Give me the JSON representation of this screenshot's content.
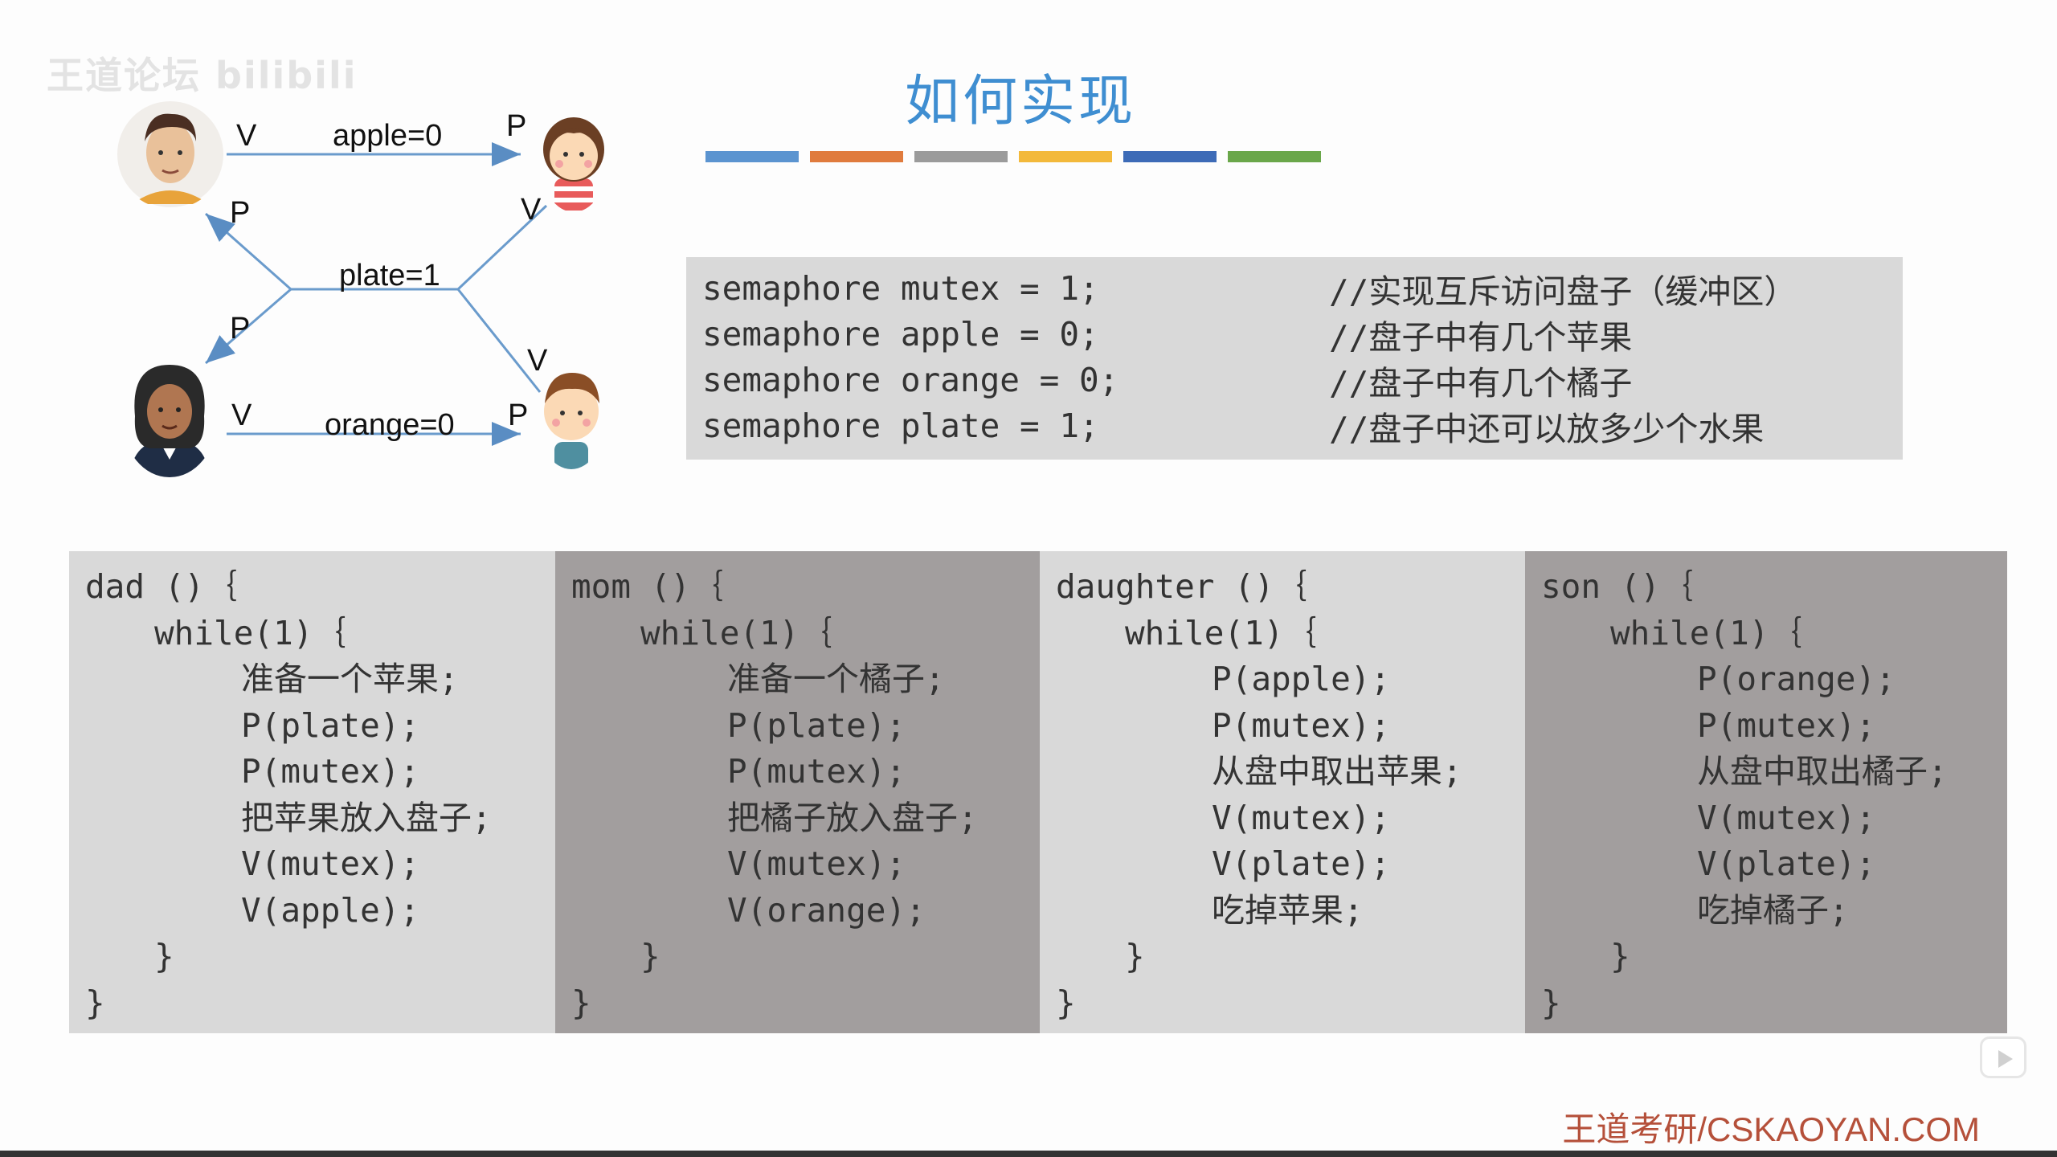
{
  "watermark": "王道论坛 bilibili",
  "title": "如何实现",
  "color_bars": [
    "#5b94d0",
    "#e07b3d",
    "#9b9b9b",
    "#f3b93b",
    "#3d6bb7",
    "#6aa74a"
  ],
  "declarations": [
    {
      "code": "semaphore mutex = 1;",
      "comment": "//实现互斥访问盘子（缓冲区）"
    },
    {
      "code": "semaphore apple = 0;",
      "comment": "//盘子中有几个苹果"
    },
    {
      "code": "semaphore orange = 0;",
      "comment": "//盘子中有几个橘子"
    },
    {
      "code": "semaphore plate = 1;",
      "comment": "//盘子中还可以放多少个水果"
    }
  ],
  "diagram": {
    "apple_label": "apple=0",
    "plate_label": "plate=1",
    "orange_label": "orange=0",
    "v_top": "V",
    "p_top": "P",
    "p_dad": "P",
    "v_daughter": "V",
    "p_mom": "P",
    "v_son": "V",
    "v_bottom": "V",
    "p_bottom": "P"
  },
  "processes": [
    {
      "header": "dad ()｛",
      "loop": "while(1)｛",
      "body": [
        "准备一个苹果;",
        "P(plate);",
        "P(mutex);",
        "把苹果放入盘子;",
        "V(mutex);",
        "V(apple);"
      ],
      "close_inner": "}",
      "close_outer": "}"
    },
    {
      "header": "mom ()｛",
      "loop": "while(1)｛",
      "body": [
        "准备一个橘子;",
        "P(plate);",
        "P(mutex);",
        "把橘子放入盘子;",
        "V(mutex);",
        "V(orange);"
      ],
      "close_inner": "}",
      "close_outer": "}"
    },
    {
      "header": "daughter ()｛",
      "loop": "while(1)｛",
      "body": [
        "P(apple);",
        "P(mutex);",
        "从盘中取出苹果;",
        "V(mutex);",
        "V(plate);",
        "吃掉苹果;"
      ],
      "close_inner": "}",
      "close_outer": "}"
    },
    {
      "header": "son ()｛",
      "loop": "while(1)｛",
      "body": [
        "P(orange);",
        "P(mutex);",
        "从盘中取出橘子;",
        "V(mutex);",
        "V(plate);",
        "吃掉橘子;"
      ],
      "close_inner": "}",
      "close_outer": "}"
    }
  ],
  "footer": "王道考研/CSKAOYAN.COM"
}
